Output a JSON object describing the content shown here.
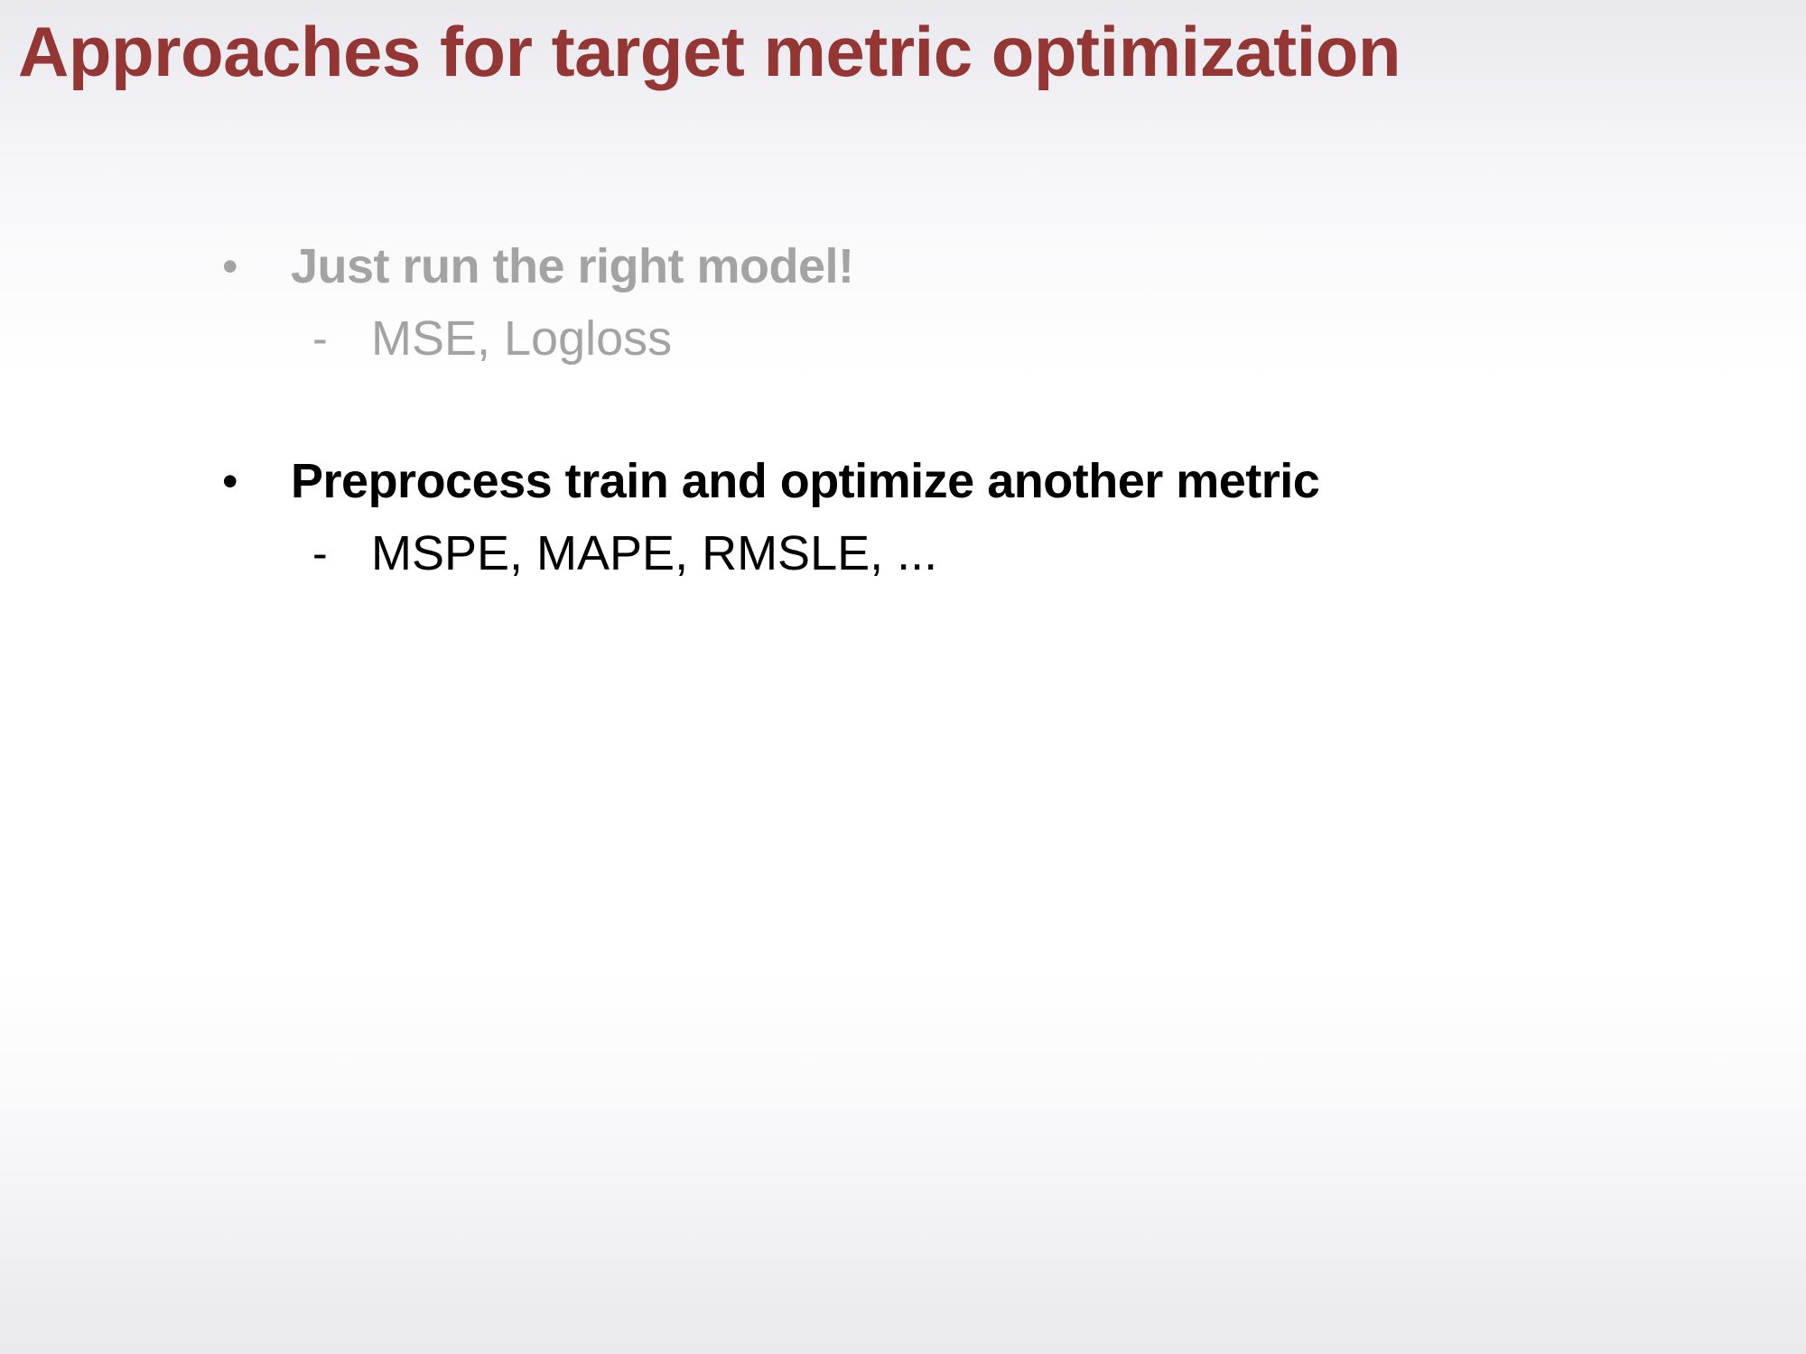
{
  "slide": {
    "title": "Approaches for target metric optimization",
    "title_color": "#943634",
    "bullets": [
      {
        "marker": "•",
        "text": "Just run the right model!",
        "color": "#a3a3a3",
        "sub_items": [
          {
            "marker": "-",
            "text": "MSE, Logloss"
          }
        ]
      },
      {
        "marker": "•",
        "text": "Preprocess train and optimize another metric",
        "color": "#000000",
        "sub_items": [
          {
            "marker": "-",
            "text": "MSPE, MAPE, RMSLE, ..."
          }
        ]
      }
    ]
  }
}
